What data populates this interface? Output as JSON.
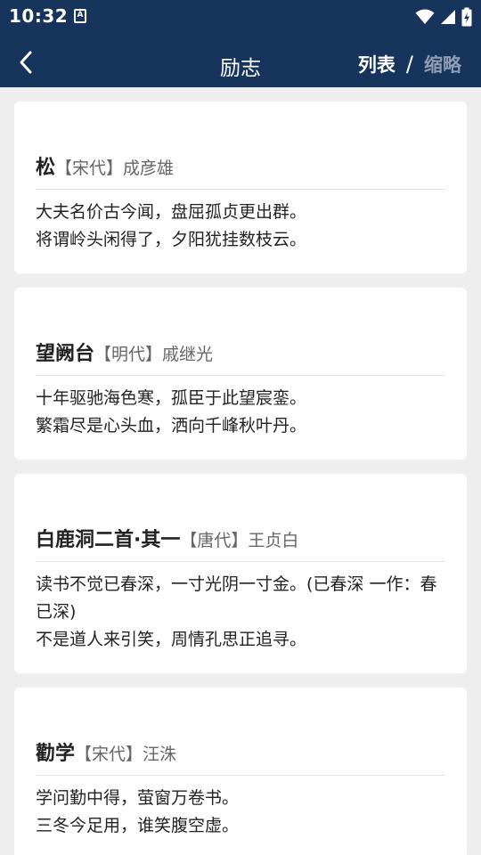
{
  "status": {
    "time": "10:32",
    "notif_glyph": "A"
  },
  "appbar": {
    "title": "励志",
    "toggle_list": "列表",
    "toggle_sep": "/",
    "toggle_thumb": "缩略"
  },
  "colors": {
    "bar": "#17345d",
    "active": "#ffffff",
    "inactive": "#8d9db3",
    "background": "#eeeeee"
  },
  "poems": [
    {
      "title": "松",
      "meta": "【宋代】成彦雄",
      "lines": [
        "大夫名价古今闻，盘屈孤贞更出群。",
        "将谓岭头闲得了，夕阳犹挂数枝云。"
      ]
    },
    {
      "title": "望阙台",
      "meta": "【明代】戚继光",
      "lines": [
        "十年驱驰海色寒，孤臣于此望宸銮。",
        "繁霜尽是心头血，洒向千峰秋叶丹。"
      ]
    },
    {
      "title": "白鹿洞二首·其一",
      "meta": "【唐代】王贞白",
      "lines": [
        "读书不觉已春深，一寸光阴一寸金。(已春深 一作：春已深)",
        "不是道人来引笑，周情孔思正追寻。"
      ]
    },
    {
      "title": "勸学",
      "meta": "【宋代】汪洙",
      "lines": [
        "学问勤中得，萤窗万卷书。",
        "三冬今足用，谁笑腹空虚。"
      ]
    }
  ]
}
